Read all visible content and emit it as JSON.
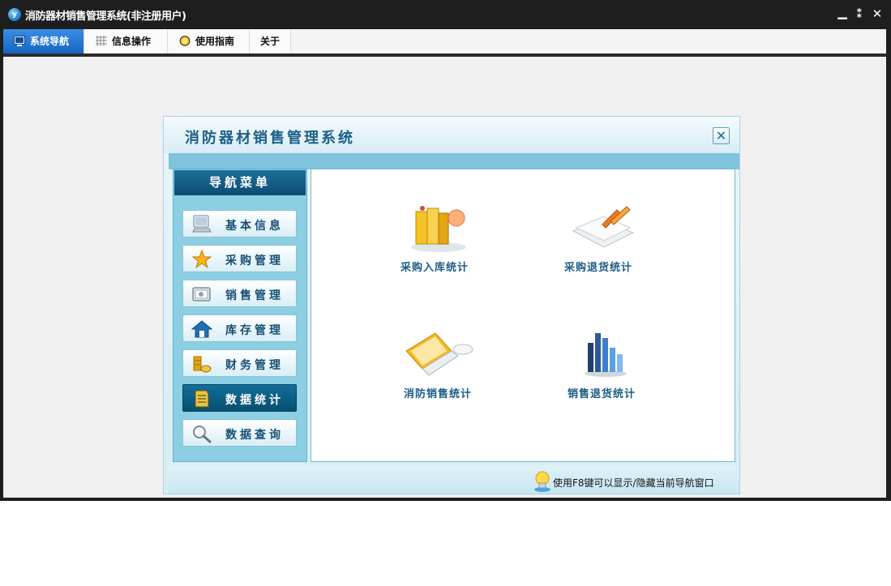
{
  "window": {
    "title": "消防器材销售管理系统(非注册用户)",
    "logo_letter": "y",
    "controls": {
      "minimize": "▁",
      "restore": "⁑",
      "close": "✕"
    }
  },
  "menu": {
    "tabs": [
      {
        "label": "系统导航",
        "icon": "monitor-icon",
        "active": true
      },
      {
        "label": "信息操作",
        "icon": "grid-icon",
        "active": false
      },
      {
        "label": "使用指南",
        "icon": "help-icon",
        "active": false
      },
      {
        "label": "关于",
        "icon": "",
        "active": false
      }
    ]
  },
  "panel": {
    "title": "消防器材销售管理系统",
    "close_glyph": "✕",
    "hint": "使用F8键可以显示/隐藏当前导航窗口"
  },
  "nav": {
    "title": "导航菜单",
    "items": [
      {
        "label": "基本信息",
        "icon": "monitor-icon"
      },
      {
        "label": "采购管理",
        "icon": "star-icon"
      },
      {
        "label": "销售管理",
        "icon": "certificate-icon"
      },
      {
        "label": "库存管理",
        "icon": "home-icon"
      },
      {
        "label": "财务管理",
        "icon": "coins-icon"
      },
      {
        "label": "数据统计",
        "icon": "document-icon",
        "active": true
      },
      {
        "label": "数据查询",
        "icon": "magnifier-icon"
      }
    ]
  },
  "stats": [
    {
      "label": "采购入库统计",
      "icon": "books-icon"
    },
    {
      "label": "采购退货统计",
      "icon": "papers-pen-icon"
    },
    {
      "label": "消防销售统计",
      "icon": "laptop-icon"
    },
    {
      "label": "销售退货统计",
      "icon": "bar-chart-icon"
    }
  ],
  "colors": {
    "accent": "#1565c0",
    "panel_title": "#1b5f88",
    "nav_active": "#0b5a7f"
  }
}
